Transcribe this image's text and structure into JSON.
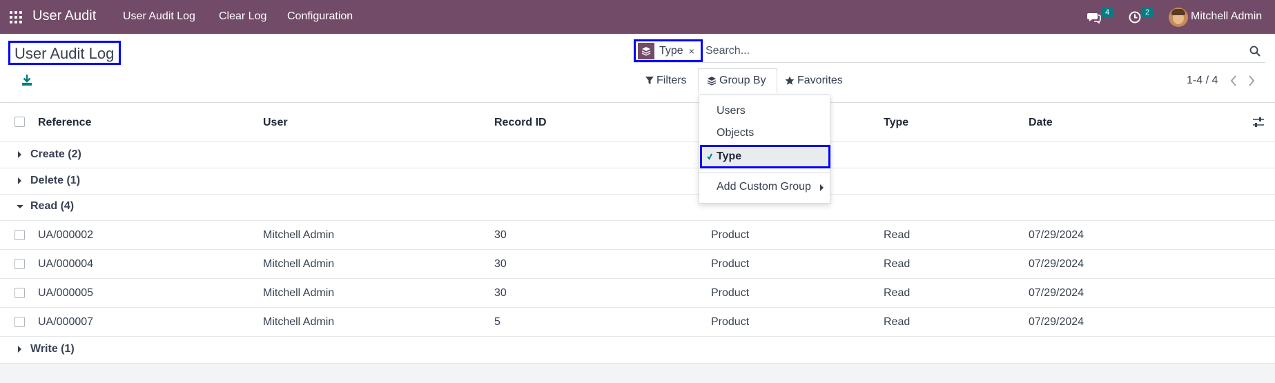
{
  "navbar": {
    "app_name": "User Audit",
    "menu": [
      "User Audit Log",
      "Clear Log",
      "Configuration"
    ],
    "messages_count": "4",
    "activities_count": "2",
    "user_name": "Mitchell Admin",
    "color": "#714b67"
  },
  "control": {
    "page_title": "User Audit Log",
    "search": {
      "facet_label": "Type",
      "facet_remove": "×",
      "placeholder": "Search..."
    },
    "filters_label": "Filters",
    "groupby_label": "Group By",
    "favorites_label": "Favorites",
    "pager": "1-4 / 4"
  },
  "list": {
    "columns": [
      "Reference",
      "User",
      "Record ID",
      "Type",
      "Date"
    ],
    "groups": {
      "create": "Create (2)",
      "delete": "Delete (1)",
      "read": "Read (4)",
      "write": "Write (1)"
    },
    "rows": [
      {
        "reference": "UA/000002",
        "user": "Mitchell Admin",
        "record_id": "30",
        "object": "Product",
        "type": "Read",
        "date": "07/29/2024"
      },
      {
        "reference": "UA/000004",
        "user": "Mitchell Admin",
        "record_id": "30",
        "object": "Product",
        "type": "Read",
        "date": "07/29/2024"
      },
      {
        "reference": "UA/000005",
        "user": "Mitchell Admin",
        "record_id": "30",
        "object": "Product",
        "type": "Read",
        "date": "07/29/2024"
      },
      {
        "reference": "UA/000007",
        "user": "Mitchell Admin",
        "record_id": "5",
        "object": "Product",
        "type": "Read",
        "date": "07/29/2024"
      }
    ]
  },
  "groupby_dropdown": {
    "options": [
      "Users",
      "Objects",
      "Type"
    ],
    "selected": "Type",
    "custom_group": "Add Custom Group"
  }
}
